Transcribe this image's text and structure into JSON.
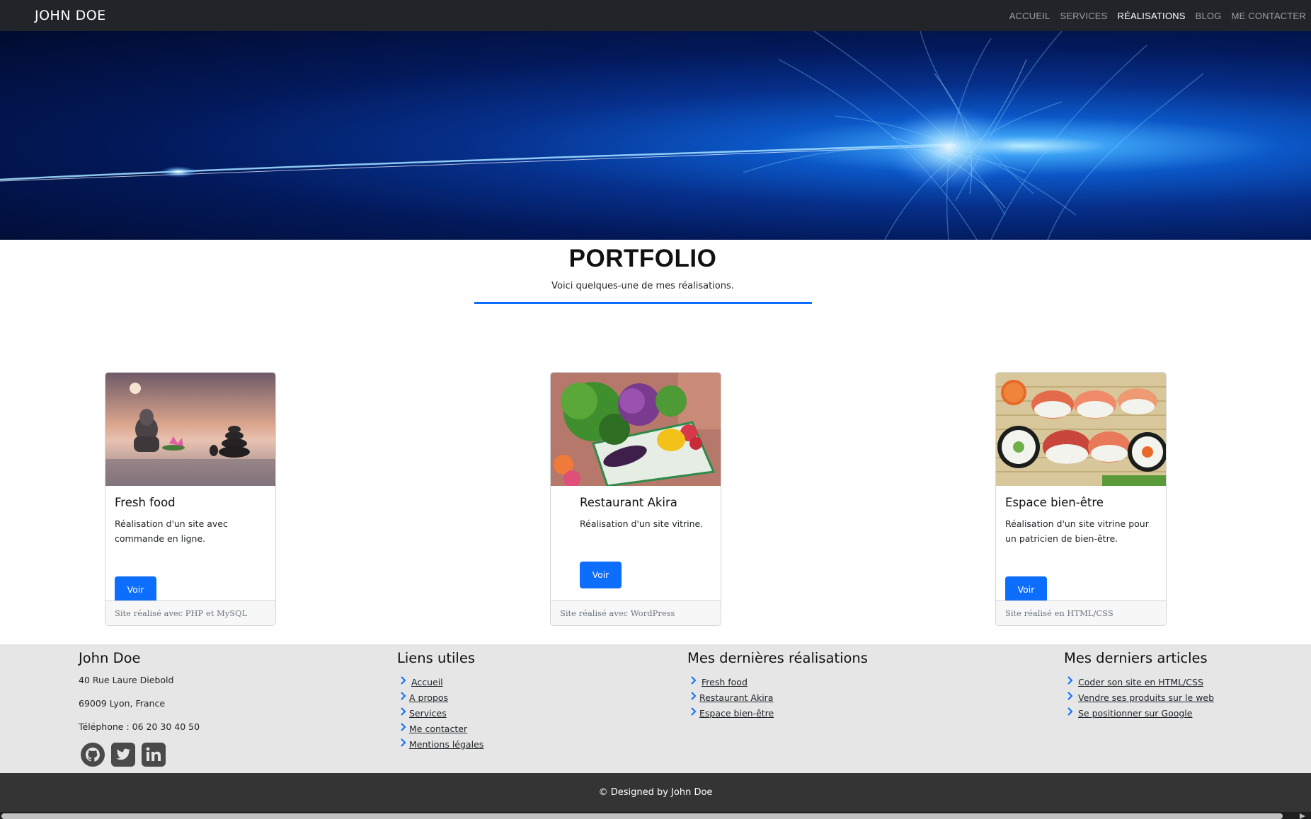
{
  "navbar": {
    "brand": "JOHN DOE",
    "links": [
      "ACCUEIL",
      "SERVICES",
      "RÉALISATIONS",
      "BLOG",
      "ME CONTACTER"
    ],
    "active": "RÉALISATIONS"
  },
  "portfolio": {
    "title": "PORTFOLIO",
    "subtitle": "Voici quelques-une de mes réalisations."
  },
  "cards": [
    {
      "title": "Fresh food",
      "text": "Réalisation d'un site avec commande en ligne.",
      "button": "Voir",
      "footer": "Site réalisé avec PHP et MySQL",
      "image": "zen-stones-buddha-image"
    },
    {
      "title": "Restaurant Akira",
      "text": "Réalisation d'un site vitrine.",
      "button": "Voir",
      "footer": "Site réalisé avec WordPress",
      "image": "vegetable-basket-image"
    },
    {
      "title": "Espace bien-être",
      "text": "Réalisation d'un site vitrine pour un patricien de bien-être.",
      "button": "Voir",
      "footer": "Site réalisé en HTML/CSS",
      "image": "sushi-platter-image"
    }
  ],
  "footer": {
    "contact": {
      "name": "John Doe",
      "address": "40 Rue Laure Diebold",
      "city": "69009 Lyon, France",
      "phone": "Téléphone : 06 20 30 40 50",
      "socials": [
        "github-icon",
        "twitter-icon",
        "linkedin-icon"
      ]
    },
    "links": {
      "title": "Liens utiles",
      "items": [
        "Accueil",
        "A propos",
        "Services",
        "Me contacter",
        "Mentions légales"
      ]
    },
    "works": {
      "title": "Mes dernières réalisations",
      "items": [
        "Fresh food",
        "Restaurant Akira",
        "Espace bien-être"
      ]
    },
    "articles": {
      "title": "Mes derniers articles",
      "items": [
        "Coder son site en HTML/CSS",
        "Vendre ses produits sur le web",
        "Se positionner sur Google"
      ]
    },
    "copyright": "© Designed by John Doe"
  },
  "colors": {
    "accent": "#0d6efd",
    "navbar": "#212529",
    "footer_bg": "#e6e6e6",
    "bottom_bar": "#343434"
  }
}
